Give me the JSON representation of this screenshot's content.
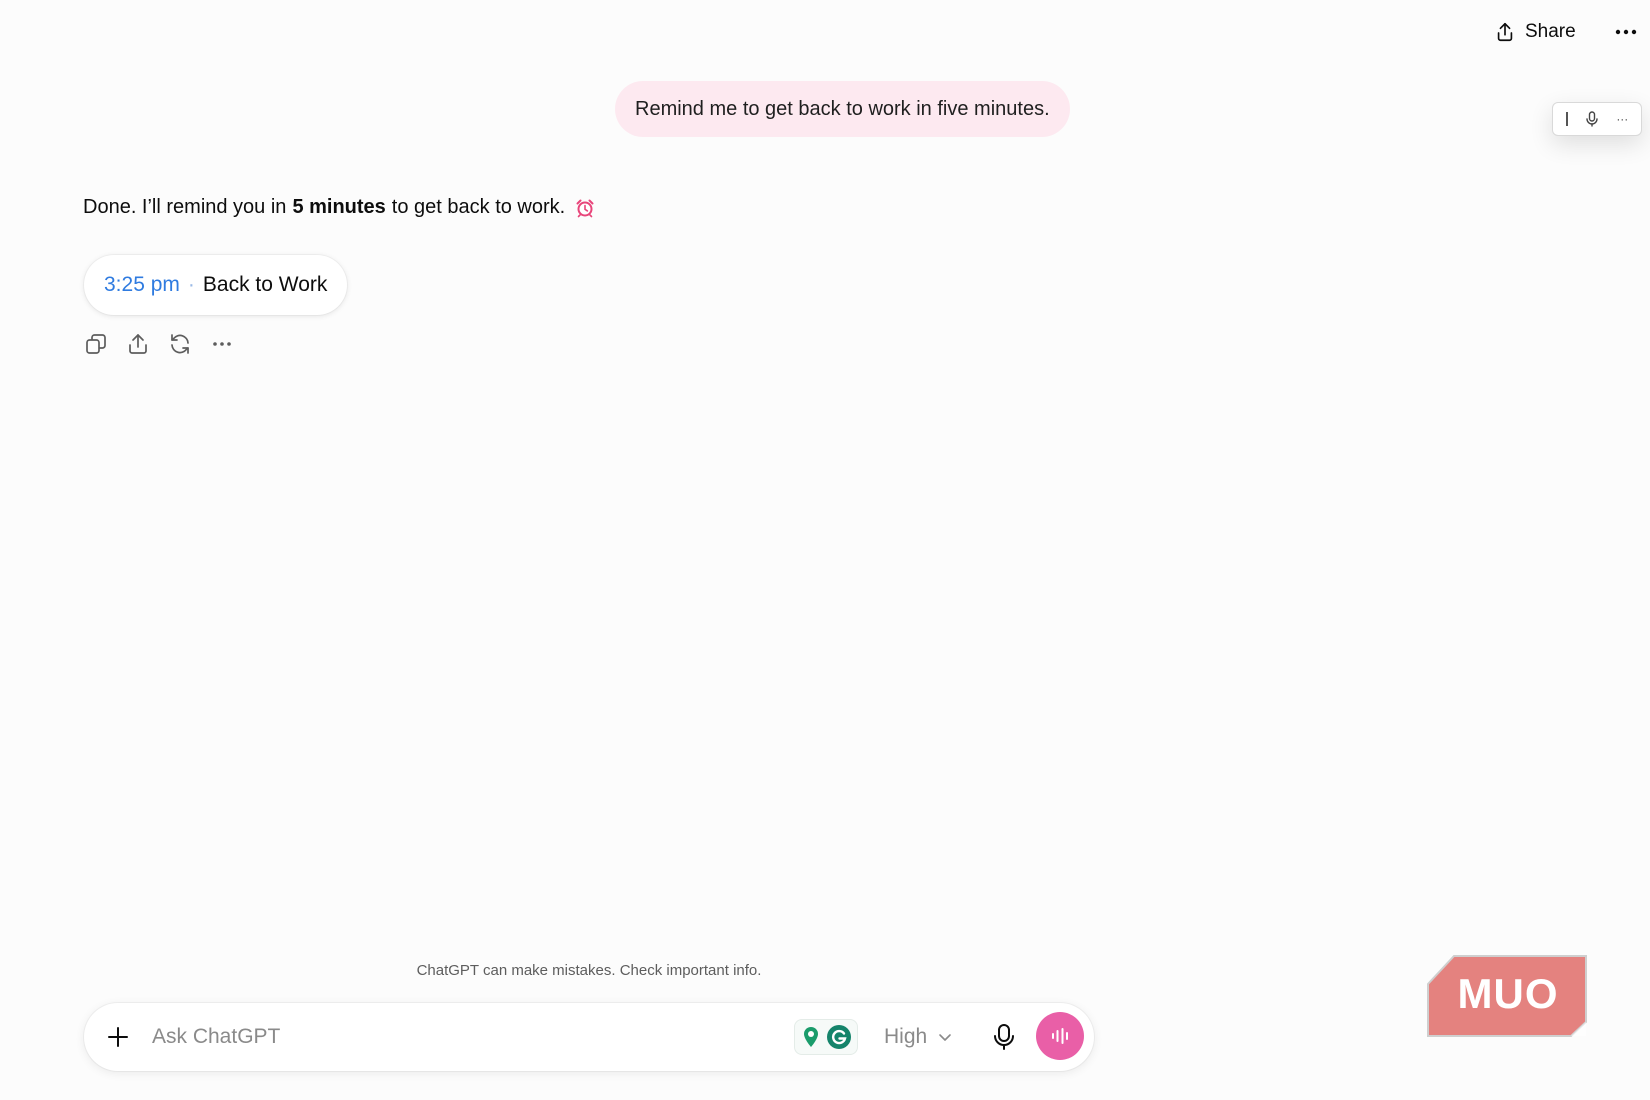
{
  "header": {
    "share_label": "Share",
    "share_icon": "share-upload-icon",
    "more_icon": "more-horizontal-icon"
  },
  "dictation_toolbar": {
    "icons": [
      "text-cursor-icon",
      "microphone-icon",
      "more-horizontal-icon"
    ],
    "more_label": "···"
  },
  "conversation": {
    "user_message": "Remind me to get back to work in five minutes.",
    "assistant": {
      "text_before": "Done. I’ll remind you in",
      "text_bold": "5 minutes",
      "text_after": "to get back to work.",
      "emoji_icon": "alarm-clock-icon"
    },
    "reminder": {
      "time": "3:25 pm",
      "separator": "·",
      "title": "Back to Work"
    },
    "actions": [
      "copy-icon",
      "share-icon",
      "regenerate-icon",
      "more-horizontal-icon"
    ]
  },
  "footer": {
    "disclaimer": "ChatGPT can make mistakes. Check important info."
  },
  "composer": {
    "placeholder": "Ask ChatGPT",
    "value": "",
    "model_label": "High",
    "extensions": [
      "location-pin-icon",
      "grammarly-icon"
    ],
    "voice_color": "#e95fa7"
  },
  "watermark": {
    "text": "MUO",
    "color": "#e4827f"
  }
}
